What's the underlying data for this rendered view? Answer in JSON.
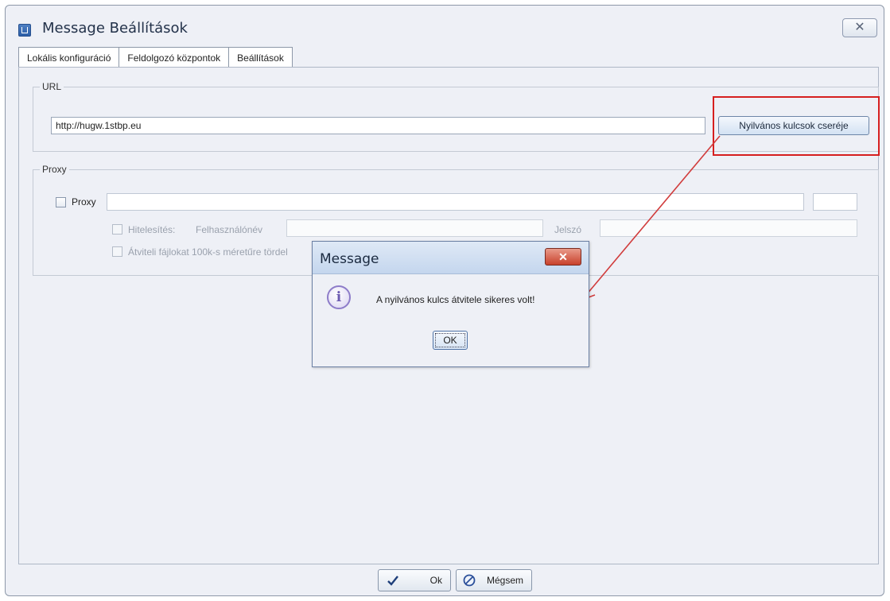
{
  "window": {
    "title": "Message Beállítások",
    "close_symbol": "✕"
  },
  "tabs": [
    {
      "label": "Lokális konfiguráció"
    },
    {
      "label": "Feldolgozó központok"
    },
    {
      "label": "Beállítások"
    }
  ],
  "url_group": {
    "label": "URL",
    "url_value": "http://hugw.1stbp.eu",
    "exchange_button": "Nyilvános kulcsok cseréje"
  },
  "proxy_group": {
    "label": "Proxy",
    "proxy_checkbox_label": "Proxy",
    "auth_label": "Hitelesítés:",
    "username_label": "Felhasználónév",
    "password_label": "Jelszó",
    "chunk_label": "Átviteli fájlokat 100k-s méretűre tördel"
  },
  "bottom_buttons": {
    "ok": "Ok",
    "cancel": "Mégsem"
  },
  "dialog": {
    "title": "Message",
    "close_symbol": "✕",
    "info_symbol": "i",
    "message": "A nyilvános kulcs átvitele sikeres volt!",
    "ok": "OK"
  },
  "colors": {
    "annotation_red": "#d61f1f"
  }
}
